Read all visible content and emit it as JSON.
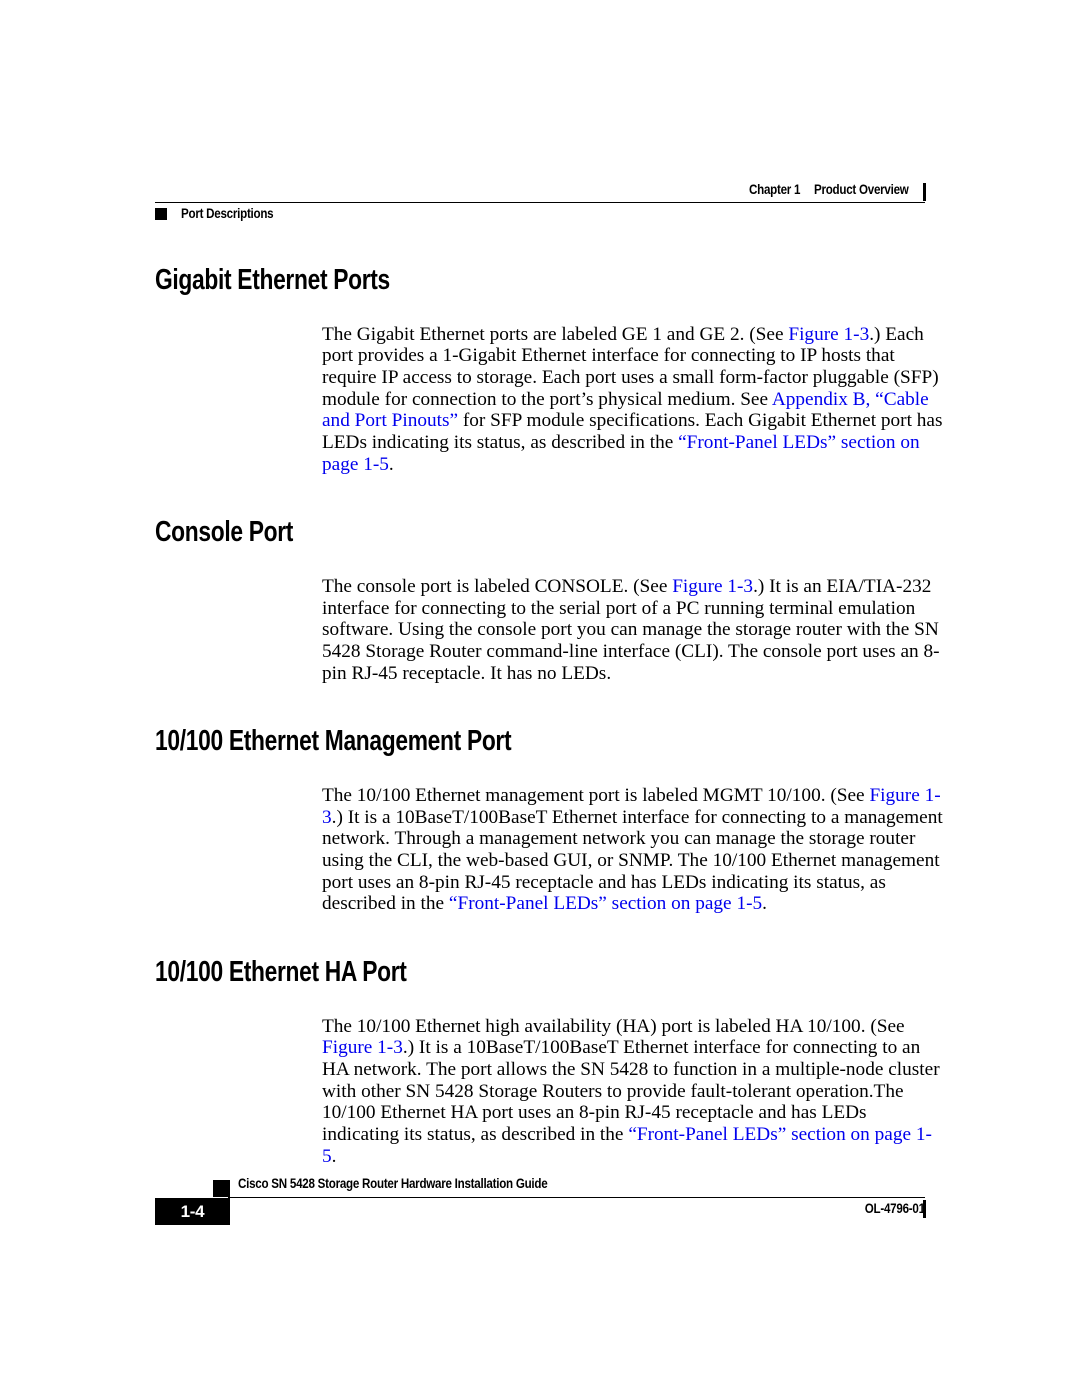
{
  "document": {
    "type": "pdf-page",
    "page_background": "#ffffff",
    "link_color": "#0000ee",
    "text_color": "#000000"
  },
  "header": {
    "chapter_label": "Chapter 1",
    "chapter_title": "Product Overview",
    "section_label": "Port Descriptions",
    "bullet_icon": "black-square-icon",
    "tick_icon": "vertical-rule-icon"
  },
  "sections": [
    {
      "heading": "Gigabit Ethernet Ports",
      "paragraph_parts": [
        {
          "text": "The Gigabit Ethernet ports are labeled GE 1 and GE 2. (See ",
          "link": false
        },
        {
          "text": "Figure 1-3",
          "link": true
        },
        {
          "text": ".) Each port provides a 1-Gigabit Ethernet interface for connecting to IP hosts that require IP access to storage. Each port uses a small form-factor pluggable (SFP) module for connection to the port’s physical medium. See ",
          "link": false
        },
        {
          "text": "Appendix B, “Cable and Port Pinouts”",
          "link": true
        },
        {
          "text": " for SFP module specifications. Each Gigabit Ethernet port has LEDs indicating its status, as described in the ",
          "link": false
        },
        {
          "text": "“Front-Panel LEDs” section on page 1-5",
          "link": true
        },
        {
          "text": ".",
          "link": false
        }
      ]
    },
    {
      "heading": "Console Port",
      "paragraph_parts": [
        {
          "text": "The console port is labeled CONSOLE. (See ",
          "link": false
        },
        {
          "text": "Figure 1-3",
          "link": true
        },
        {
          "text": ".) It is an EIA/TIA-232 interface for connecting to the serial port of a PC running terminal emulation software. Using the console port you can manage the storage router with the SN 5428 Storage Router command-line interface (CLI). The console port uses an 8-pin RJ-45 receptacle. It has no LEDs.",
          "link": false
        }
      ]
    },
    {
      "heading": "10/100 Ethernet Management Port",
      "paragraph_parts": [
        {
          "text": "The 10/100 Ethernet management port is labeled MGMT 10/100. (See ",
          "link": false
        },
        {
          "text": "Figure 1-3",
          "link": true
        },
        {
          "text": ".) It is a 10BaseT/100BaseT Ethernet interface for connecting to a management network. Through a management network you can manage the storage router using the CLI, the web-based GUI, or SNMP. The 10/100 Ethernet management port uses an 8-pin RJ-45 receptacle and has LEDs indicating its status, as described in the ",
          "link": false
        },
        {
          "text": "“Front-Panel LEDs” section on page 1-5",
          "link": true
        },
        {
          "text": ".",
          "link": false
        }
      ]
    },
    {
      "heading": "10/100 Ethernet HA Port",
      "paragraph_parts": [
        {
          "text": "The 10/100 Ethernet high availability (HA) port is labeled HA 10/100. (See ",
          "link": false
        },
        {
          "text": "Figure 1-3",
          "link": true
        },
        {
          "text": ".) It is a 10BaseT/100BaseT Ethernet interface for connecting to an HA network. The port allows the SN 5428 to function in a multiple-node cluster with other SN 5428 Storage Routers to provide fault-tolerant operation.The 10/100 Ethernet HA port uses an 8-pin RJ-45 receptacle and has LEDs indicating its status, as described in the ",
          "link": false
        },
        {
          "text": "“Front-Panel LEDs” section on page 1-5",
          "link": true
        },
        {
          "text": ".",
          "link": false
        }
      ]
    }
  ],
  "footer": {
    "page_number": "1-4",
    "guide_title": "Cisco SN 5428 Storage Router Hardware Installation Guide",
    "doc_number": "OL-4796-01",
    "bullet_icon": "black-square-icon",
    "tick_icon": "vertical-rule-icon"
  }
}
